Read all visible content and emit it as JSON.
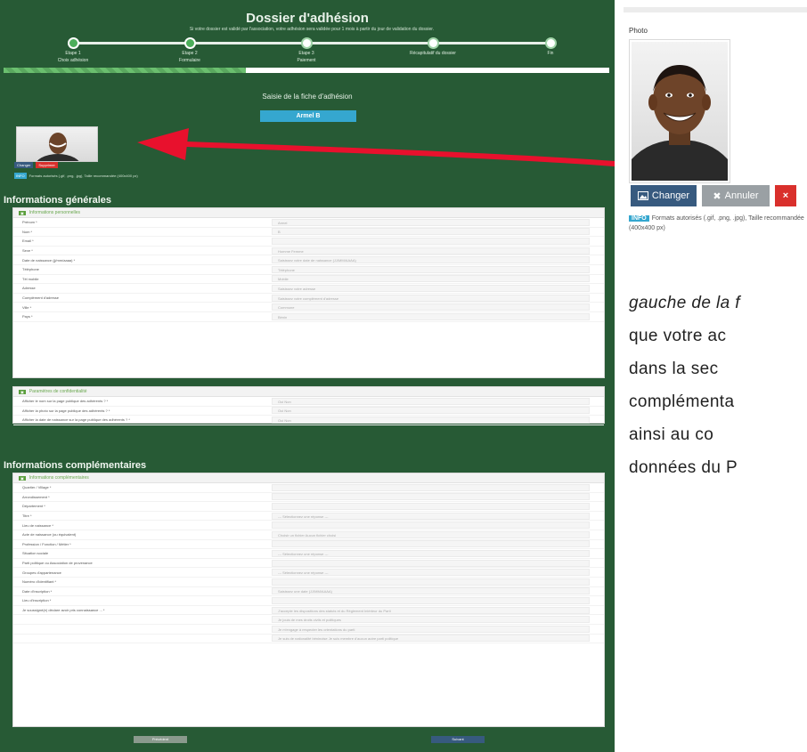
{
  "form": {
    "title": "Dossier d'adhésion",
    "subtitle": "Si votre dossier est validé par l'association, votre adhésion sera validée pour 1 mois à partir du jour de validation du dossier.",
    "steps": [
      {
        "label": "Etape 1",
        "sub": "Choix adhésion"
      },
      {
        "label": "Etape 2",
        "sub": "Formulaire"
      },
      {
        "label": "Etape 3",
        "sub": "Paiement"
      },
      {
        "label": "Récapitulatif du dossier",
        "sub": ""
      },
      {
        "label": "Fin",
        "sub": ""
      }
    ],
    "progress_percent": 40,
    "fiche_title": "Saisie de la fiche d'adhésion",
    "member_name": "Armel B",
    "small_change_label": "Changer",
    "small_delete_label": "Supprimer",
    "small_info_badge": "INFO",
    "small_info_text": "Formats autorisés (.gif, .png, .jpg), Taille recommandée (400x400 px)",
    "general": {
      "heading": "Informations générales",
      "panel1_title": "Informations personnelles",
      "rows": [
        {
          "label": "Prénom *",
          "value": "Armel"
        },
        {
          "label": "Nom *",
          "value": "B"
        },
        {
          "label": "Email *",
          "value": ""
        },
        {
          "label": "Sexe *",
          "value": "Homme   Femme"
        },
        {
          "label": "Date de naissance (jj/mm/aaaa) *",
          "value": "Saisissez votre date de naissance (JJ/MM/AAAA)"
        },
        {
          "label": "Téléphone",
          "value": "Téléphone"
        },
        {
          "label": "Tél mobile",
          "value": "Mobile"
        },
        {
          "label": "Adresse",
          "value": "Saisissez votre adresse"
        },
        {
          "label": "Complément d'adresse",
          "value": "Saisissez votre complément d'adresse"
        },
        {
          "label": "Ville *",
          "value": "Commune"
        },
        {
          "label": "Pays *",
          "value": "Bénin"
        }
      ],
      "panel2_title": "Paramètres de confidentialité",
      "privacy_rows": [
        {
          "label": "Afficher le nom sur la page publique des adhérents ? *",
          "value": "Oui   Non"
        },
        {
          "label": "Afficher la photo sur la page publique des adhérents ? *",
          "value": "Oui   Non"
        },
        {
          "label": "Afficher la date de naissance sur la page publique des adhérents ? *",
          "value": "Oui   Non"
        }
      ]
    },
    "extra": {
      "heading": "Informations complémentaires",
      "panel_title": "Informations complémentaires",
      "rows": [
        {
          "label": "Quartier / Village *",
          "value": ""
        },
        {
          "label": "Arrondissement *",
          "value": ""
        },
        {
          "label": "Département *",
          "value": ""
        },
        {
          "label": "Titre *",
          "value": "--- Sélectionnez une réponse ---"
        },
        {
          "label": "Lieu de naissance *",
          "value": ""
        },
        {
          "label": "Acte de naissance (ou équivalent)",
          "value": "Choisir un fichier   Aucun fichier choisi"
        },
        {
          "label": "Profession / Fonction / Métier *",
          "value": ""
        },
        {
          "label": "Situation sociale",
          "value": "--- Sélectionnez une réponse ---"
        },
        {
          "label": "Parti politique ou Association de provenance",
          "value": ""
        },
        {
          "label": "Groupes d'appartenance",
          "value": "--- Sélectionnez une réponse ---"
        },
        {
          "label": "Numéro d'identifiant *",
          "value": ""
        },
        {
          "label": "Date d'inscription *",
          "value": "Saisissez une date (JJ/MM/AAAA)"
        },
        {
          "label": "Lieu d'inscription *",
          "value": ""
        },
        {
          "label": "Je soussigné(e) déclare avoir pris connaissance ... *",
          "value": "J'accepte les dispositions des statuts et du Règlement Intérieur du Parti"
        },
        {
          "label": "",
          "value": "Je jouis de mes droits civils et politiques"
        },
        {
          "label": "",
          "value": "Je m'engage à respecter les orientations du parti"
        },
        {
          "label": "",
          "value": "Je suis de nationalité béninoise   Je suis membre d'aucun autre parti politique"
        }
      ]
    },
    "prev_label": "Précédent",
    "next_label": "Suivant"
  },
  "widget": {
    "photo_label": "Photo",
    "change_label": "Changer",
    "cancel_label": "Annuler",
    "delete_label": "×",
    "info_badge": "INFO",
    "info_text": "Formats autorisés (.gif, .png, .jpg), Taille recommandée (400x400 px)"
  },
  "document_text": {
    "lines": [
      "gauche de la f",
      "que votre ac",
      "dans la sec",
      "complémenta",
      "ainsi au co",
      "données du P"
    ]
  },
  "colors": {
    "form_background": "#275a35",
    "arrow": "#e8112d",
    "info_badge": "#35a7cf",
    "change_button": "#375a7f",
    "cancel_button": "#9aa0a4",
    "delete_button": "#d9302c"
  }
}
